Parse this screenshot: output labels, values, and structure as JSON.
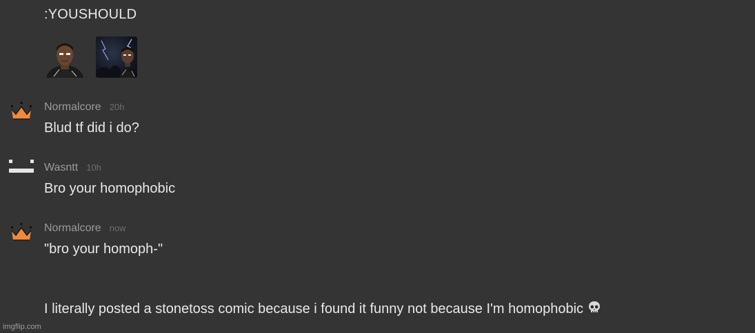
{
  "header": {
    "emote_text": ":YOUSHOULD"
  },
  "emotes": [
    {
      "icon": "man-face-emote-icon"
    },
    {
      "icon": "man-lightning-emote-icon"
    }
  ],
  "messages": [
    {
      "username": "Normalcore",
      "timestamp": "20h",
      "avatar": "crown-icon",
      "lines": [
        "Blud tf did i do?"
      ]
    },
    {
      "username": "Wasntt",
      "timestamp": "10h",
      "avatar": "pixel-face-icon",
      "lines": [
        "Bro your homophobic"
      ]
    },
    {
      "username": "Normalcore",
      "timestamp": "now",
      "avatar": "crown-icon",
      "lines": [
        "\"bro your homoph-\"",
        "I literally posted a stonetoss comic because i found it funny not because I'm homophobic"
      ],
      "trailing_emoji": "skull-icon"
    }
  ],
  "colors": {
    "background": "#343434",
    "crown": "#f08a3a",
    "username": "#9a9a9a",
    "timestamp": "#6e6e6e",
    "text": "#e8e8e8"
  },
  "watermark": "imgflip.com"
}
